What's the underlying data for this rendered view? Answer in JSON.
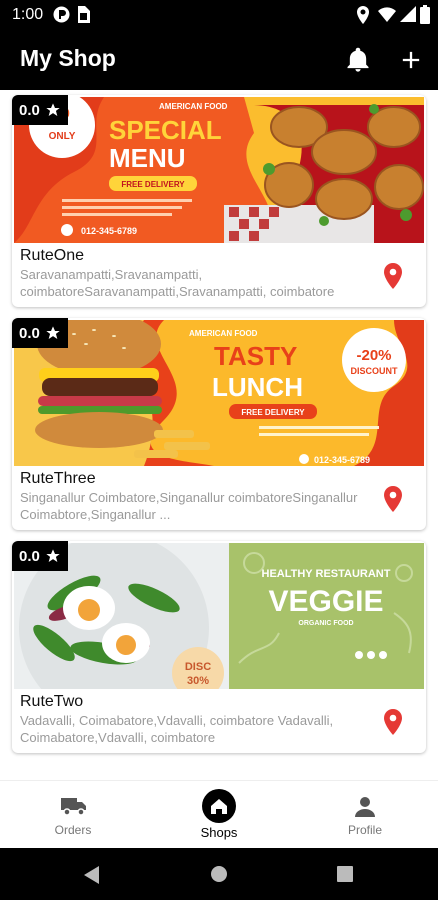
{
  "status_bar": {
    "time": "1:00"
  },
  "app_bar": {
    "title": "My Shop"
  },
  "shops": [
    {
      "rating": "0.0",
      "name": "RuteOne",
      "address": "Saravanampatti,Sravanampatti, coimbatoreSaravanampatti,Sravanampatti, coimbatore",
      "banner": {
        "top_text": "AMERICAN FOOD",
        "badge": "ONLY",
        "headline_1": "SPECIAL",
        "headline_2": "MENU",
        "pill": "FREE DELIVERY",
        "phone": "012-345-6789"
      }
    },
    {
      "rating": "0.0",
      "name": "RuteThree",
      "address": "Singanallur Coimbatore,Singanallur coimbatoreSinganallur Coimabtore,Singanallur ...",
      "banner": {
        "top_text": "AMERICAN FOOD",
        "headline_1": "TASTY",
        "headline_2": "LUNCH",
        "pill": "FREE DELIVERY",
        "discount": "-20%",
        "discount_word": "DISCOUNT",
        "phone": "012-345-6789"
      }
    },
    {
      "rating": "0.0",
      "name": "RuteTwo",
      "address": "Vadavalli, Coimabatore,Vdavalli, coimbatore Vadavalli, Coimabatore,Vdavalli, coimbatore",
      "banner": {
        "top_text": "HEALTHY RESTAURANT",
        "headline": "VEGGIE",
        "sub": "ORGANIC FOOD",
        "disc": "DISC",
        "disc_pct": "30%"
      }
    }
  ],
  "bottom_nav": {
    "items": [
      {
        "label": "Orders",
        "icon": "truck-icon"
      },
      {
        "label": "Shops",
        "icon": "store-icon",
        "active": true
      },
      {
        "label": "Profile",
        "icon": "person-icon"
      }
    ]
  },
  "colors": {
    "app_bar": "#000000",
    "pin": "#e53935",
    "orange": "#f15a22",
    "yellow": "#ffc726",
    "green": "#a8c26a"
  }
}
